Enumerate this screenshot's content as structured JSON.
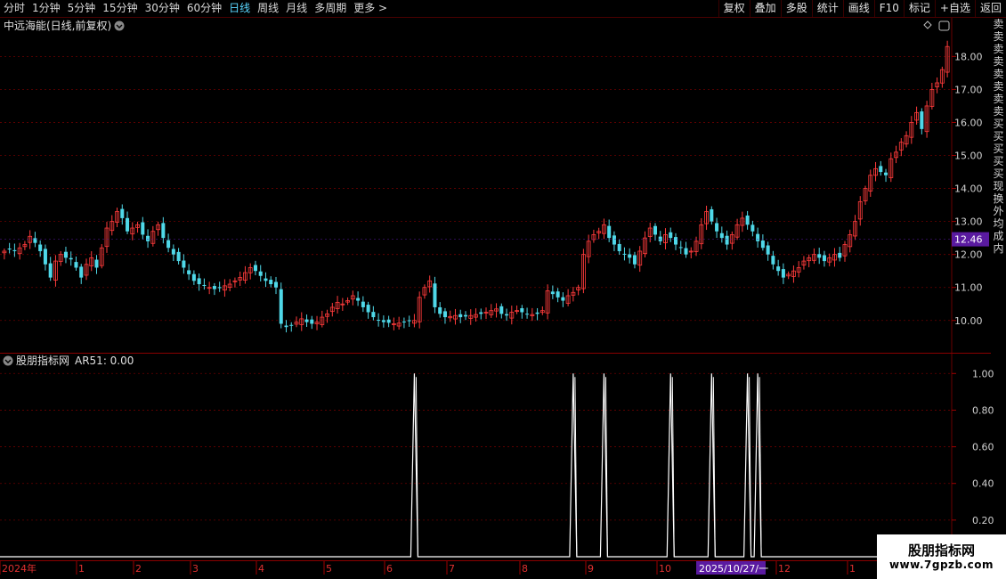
{
  "toolbar": {
    "periods": [
      "分时",
      "1分钟",
      "5分钟",
      "15分钟",
      "30分钟",
      "60分钟",
      "日线",
      "周线",
      "月线",
      "多周期",
      "更多 >"
    ],
    "active_period": "日线",
    "right_buttons": [
      "复权",
      "叠加",
      "多股",
      "统计",
      "画线",
      "F10",
      "标记",
      "+自选",
      "返回"
    ]
  },
  "main_panel": {
    "title": "中远海能(日线,前复权)",
    "current_price_label": "12.46"
  },
  "indicator_panel": {
    "title": "股朋指标网",
    "readout": "AR51: 0.00"
  },
  "side_strip_chars": [
    "卖",
    "卖",
    "卖",
    "卖",
    "卖",
    "卖",
    "卖",
    "卖",
    "买",
    "买",
    "买",
    "买",
    "买",
    "现",
    "换",
    "外",
    "均",
    "成",
    "内"
  ],
  "x_axis": {
    "labels": [
      "2024年",
      "1",
      "2",
      "3",
      "4",
      "5",
      "6",
      "7",
      "8",
      "9",
      "10",
      "11",
      "12",
      "1"
    ],
    "highlight_date": "2025/10/27/一"
  },
  "watermark": {
    "title": "股朋指标网",
    "url": "www.7gpzb.com"
  },
  "colors": {
    "up": "#ff3b3b",
    "down": "#4fd8e8",
    "grid": "#6a0000",
    "price_tag": "#5a1aa0",
    "date_tag": "#5a1aa0",
    "signal": "#ffffff"
  },
  "chart_data": [
    {
      "type": "candlestick",
      "y_ticks": [
        10.0,
        11.0,
        12.0,
        13.0,
        14.0,
        15.0,
        16.0,
        17.0,
        18.0
      ],
      "y_tick_labels": [
        "10.00",
        "11.00",
        "12.00",
        "13.00",
        "14.00",
        "15.00",
        "16.00",
        "17.00",
        "18.00"
      ],
      "ylim": [
        9.4,
        18.9
      ],
      "close": [
        12.1,
        12.15,
        12.1,
        12.2,
        12.3,
        12.55,
        12.35,
        12.1,
        11.7,
        11.3,
        11.8,
        12.0,
        11.9,
        11.85,
        11.6,
        11.3,
        11.7,
        11.9,
        11.6,
        12.2,
        12.8,
        13.0,
        13.3,
        13.1,
        12.7,
        12.8,
        12.9,
        12.6,
        12.4,
        12.7,
        12.9,
        12.5,
        12.2,
        12.0,
        11.8,
        11.6,
        11.4,
        11.2,
        11.1,
        11.05,
        11.0,
        10.95,
        10.98,
        11.05,
        11.1,
        11.2,
        11.3,
        11.45,
        11.6,
        11.5,
        11.35,
        11.2,
        11.1,
        11.0,
        9.9,
        9.8,
        9.85,
        9.95,
        10.05,
        9.95,
        9.9,
        9.95,
        10.1,
        10.2,
        10.4,
        10.55,
        10.5,
        10.6,
        10.75,
        10.6,
        10.4,
        10.25,
        10.1,
        10.0,
        9.95,
        9.93,
        9.9,
        9.92,
        9.95,
        9.98,
        10.0,
        10.7,
        11.0,
        11.2,
        10.4,
        10.2,
        10.1,
        10.12,
        10.15,
        10.1,
        10.12,
        10.15,
        10.18,
        10.2,
        10.25,
        10.3,
        10.35,
        10.2,
        10.15,
        10.25,
        10.3,
        10.25,
        10.2,
        10.18,
        10.2,
        10.3,
        10.9,
        10.8,
        10.7,
        10.6,
        10.75,
        10.85,
        11.0,
        12.0,
        12.4,
        12.6,
        12.7,
        12.9,
        12.5,
        12.3,
        12.1,
        12.0,
        11.9,
        11.7,
        12.1,
        12.5,
        12.8,
        12.6,
        12.4,
        12.6,
        12.5,
        12.3,
        12.2,
        12.0,
        12.1,
        12.4,
        12.9,
        13.3,
        13.0,
        12.7,
        12.5,
        12.3,
        12.6,
        12.9,
        13.1,
        12.9,
        12.7,
        12.4,
        12.2,
        12.0,
        11.7,
        11.5,
        11.3,
        11.4,
        11.5,
        11.6,
        11.8,
        11.9,
        12.0,
        11.9,
        11.8,
        11.9,
        12.0,
        11.9,
        12.3,
        12.6,
        13.0,
        13.6,
        14.0,
        14.4,
        14.6,
        14.5,
        14.4,
        14.9,
        15.1,
        15.4,
        15.6,
        16.0,
        16.3,
        15.8,
        16.5,
        17.0,
        17.2,
        17.6,
        18.3
      ],
      "up_count_approx": 90,
      "last_close": 12.46
    },
    {
      "type": "line",
      "name": "AR51",
      "y_ticks": [
        0.2,
        0.4,
        0.6,
        0.8,
        1.0
      ],
      "y_tick_labels": [
        "0.20",
        "0.40",
        "0.60",
        "0.80",
        "1.00"
      ],
      "ylim": [
        0.0,
        1.05
      ],
      "signal_positions": [
        80,
        111,
        117,
        130,
        138,
        145,
        147
      ],
      "signal_value": 1.0,
      "baseline_value": 0.0
    }
  ]
}
